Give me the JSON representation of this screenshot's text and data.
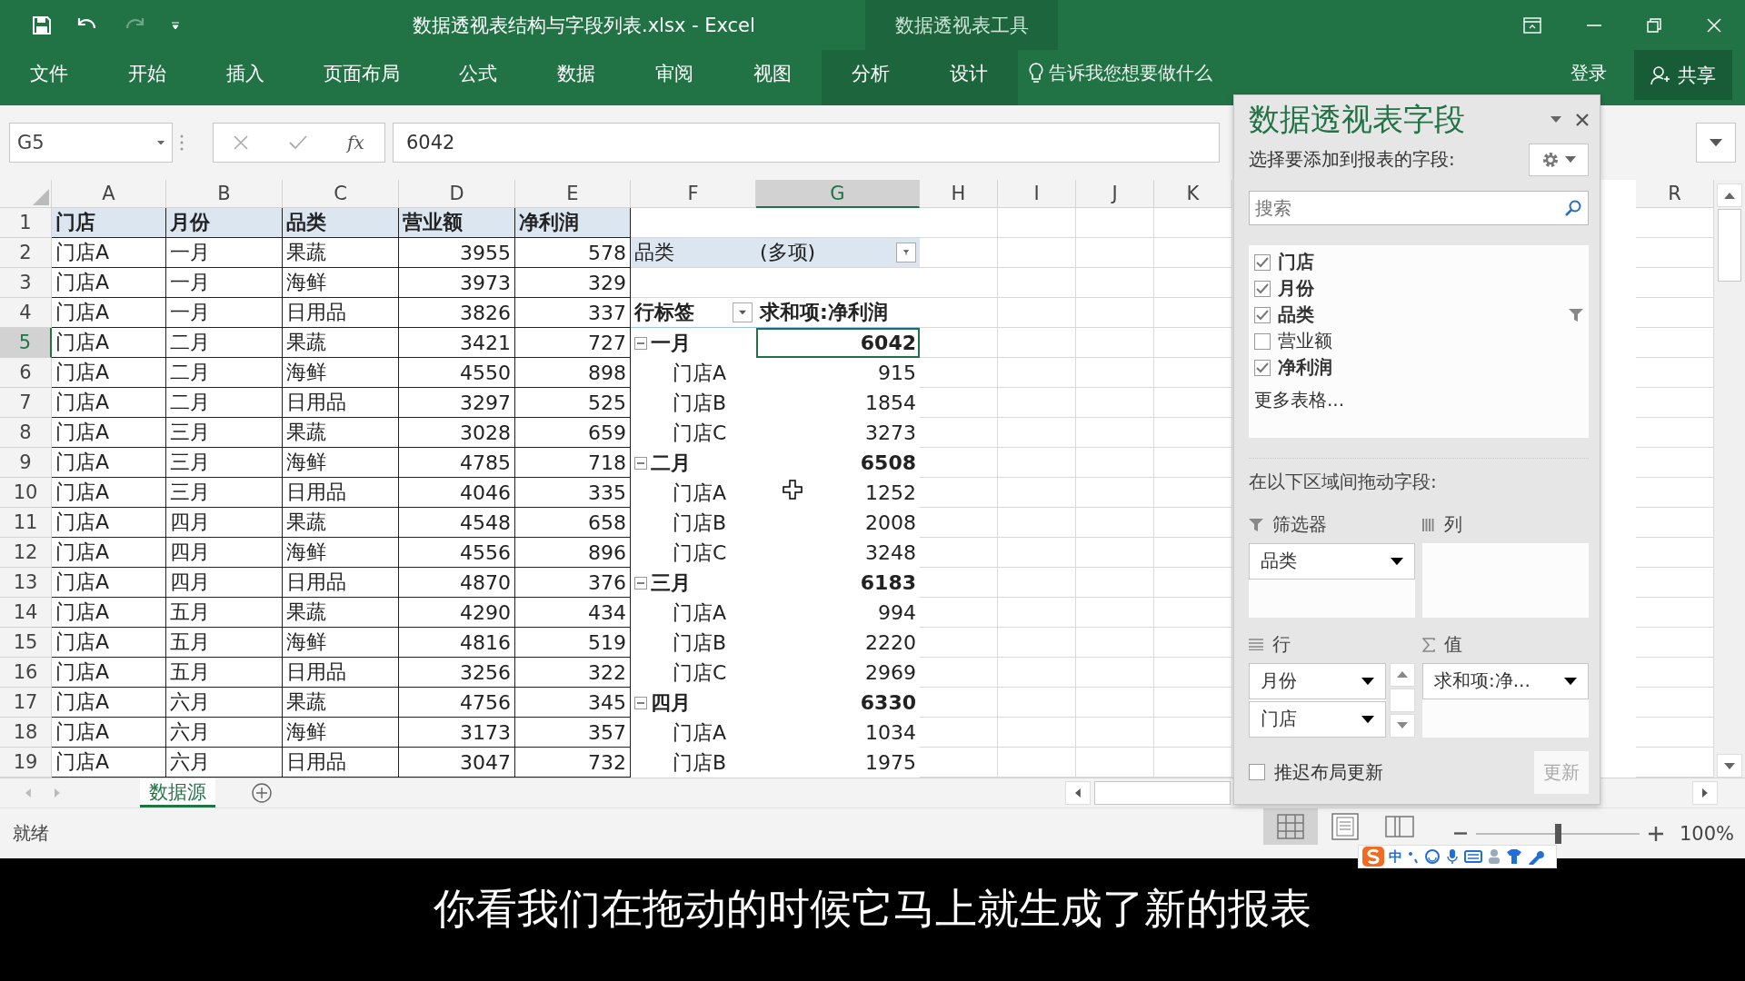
{
  "title_bar": {
    "title": "数据透视表结构与字段列表.xlsx - Excel",
    "context_label": "数据透视表工具"
  },
  "ribbon": {
    "tabs": [
      {
        "label": "文件",
        "selected": false,
        "contextual": false
      },
      {
        "label": "开始",
        "selected": false,
        "contextual": false
      },
      {
        "label": "插入",
        "selected": false,
        "contextual": false
      },
      {
        "label": "页面布局",
        "selected": false,
        "contextual": false
      },
      {
        "label": "公式",
        "selected": false,
        "contextual": false
      },
      {
        "label": "数据",
        "selected": false,
        "contextual": false
      },
      {
        "label": "审阅",
        "selected": false,
        "contextual": false
      },
      {
        "label": "视图",
        "selected": false,
        "contextual": false
      },
      {
        "label": "分析",
        "selected": false,
        "contextual": true
      },
      {
        "label": "设计",
        "selected": false,
        "contextual": true
      }
    ],
    "tell_me": "告诉我您想要做什么",
    "sign_in": "登录",
    "share": "共享"
  },
  "formula_bar": {
    "name_box": "G5",
    "function_label": "fx",
    "value": "6042"
  },
  "sheet": {
    "columns": [
      {
        "label": "A",
        "selected": false
      },
      {
        "label": "B",
        "selected": false
      },
      {
        "label": "C",
        "selected": false
      },
      {
        "label": "D",
        "selected": false
      },
      {
        "label": "E",
        "selected": false
      },
      {
        "label": "F",
        "selected": false
      },
      {
        "label": "G",
        "selected": true
      },
      {
        "label": "H",
        "selected": false
      },
      {
        "label": "I",
        "selected": false
      },
      {
        "label": "J",
        "selected": false
      },
      {
        "label": "K",
        "selected": false
      },
      {
        "label": "R",
        "selected": false
      }
    ],
    "row_headers": [
      {
        "label": "1",
        "selected": false
      },
      {
        "label": "2",
        "selected": false
      },
      {
        "label": "3",
        "selected": false
      },
      {
        "label": "4",
        "selected": false
      },
      {
        "label": "5",
        "selected": true
      },
      {
        "label": "6",
        "selected": false
      },
      {
        "label": "7",
        "selected": false
      },
      {
        "label": "8",
        "selected": false
      },
      {
        "label": "9",
        "selected": false
      },
      {
        "label": "10",
        "selected": false
      },
      {
        "label": "11",
        "selected": false
      },
      {
        "label": "12",
        "selected": false
      },
      {
        "label": "13",
        "selected": false
      },
      {
        "label": "14",
        "selected": false
      },
      {
        "label": "15",
        "selected": false
      },
      {
        "label": "16",
        "selected": false
      },
      {
        "label": "17",
        "selected": false
      },
      {
        "label": "18",
        "selected": false
      },
      {
        "label": "19",
        "selected": false
      }
    ],
    "source_table": {
      "header": [
        "门店",
        "月份",
        "品类",
        "营业额",
        "净利润"
      ],
      "rows": [
        [
          "门店A",
          "一月",
          "果蔬",
          "3955",
          "578"
        ],
        [
          "门店A",
          "一月",
          "海鲜",
          "3973",
          "329"
        ],
        [
          "门店A",
          "一月",
          "日用品",
          "3826",
          "337"
        ],
        [
          "门店A",
          "二月",
          "果蔬",
          "3421",
          "727"
        ],
        [
          "门店A",
          "二月",
          "海鲜",
          "4550",
          "898"
        ],
        [
          "门店A",
          "二月",
          "日用品",
          "3297",
          "525"
        ],
        [
          "门店A",
          "三月",
          "果蔬",
          "3028",
          "659"
        ],
        [
          "门店A",
          "三月",
          "海鲜",
          "4785",
          "718"
        ],
        [
          "门店A",
          "三月",
          "日用品",
          "4046",
          "335"
        ],
        [
          "门店A",
          "四月",
          "果蔬",
          "4548",
          "658"
        ],
        [
          "门店A",
          "四月",
          "海鲜",
          "4556",
          "896"
        ],
        [
          "门店A",
          "四月",
          "日用品",
          "4870",
          "376"
        ],
        [
          "门店A",
          "五月",
          "果蔬",
          "4290",
          "434"
        ],
        [
          "门店A",
          "五月",
          "海鲜",
          "4816",
          "519"
        ],
        [
          "门店A",
          "五月",
          "日用品",
          "3256",
          "322"
        ],
        [
          "门店A",
          "六月",
          "果蔬",
          "4756",
          "345"
        ],
        [
          "门店A",
          "六月",
          "海鲜",
          "3173",
          "357"
        ],
        [
          "门店A",
          "六月",
          "日用品",
          "3047",
          "732"
        ]
      ]
    },
    "pivot_table": {
      "filter": {
        "field": "品类",
        "value": "(多项)"
      },
      "row_label_header": "行标签",
      "value_header": "求和项:净利润",
      "rows": [
        {
          "kind": "group",
          "label": "一月",
          "value": "6042",
          "expanded": true,
          "selected": true
        },
        {
          "kind": "item",
          "label": "门店A",
          "value": "915",
          "selected": false
        },
        {
          "kind": "item",
          "label": "门店B",
          "value": "1854",
          "selected": false
        },
        {
          "kind": "item",
          "label": "门店C",
          "value": "3273",
          "selected": false
        },
        {
          "kind": "group",
          "label": "二月",
          "value": "6508",
          "expanded": true,
          "selected": false
        },
        {
          "kind": "item",
          "label": "门店A",
          "value": "1252",
          "selected": false
        },
        {
          "kind": "item",
          "label": "门店B",
          "value": "2008",
          "selected": false
        },
        {
          "kind": "item",
          "label": "门店C",
          "value": "3248",
          "selected": false
        },
        {
          "kind": "group",
          "label": "三月",
          "value": "6183",
          "expanded": true,
          "selected": false
        },
        {
          "kind": "item",
          "label": "门店A",
          "value": "994",
          "selected": false
        },
        {
          "kind": "item",
          "label": "门店B",
          "value": "2220",
          "selected": false
        },
        {
          "kind": "item",
          "label": "门店C",
          "value": "2969",
          "selected": false
        },
        {
          "kind": "group",
          "label": "四月",
          "value": "6330",
          "expanded": true,
          "selected": false
        },
        {
          "kind": "item",
          "label": "门店A",
          "value": "1034",
          "selected": false
        },
        {
          "kind": "item",
          "label": "门店B",
          "value": "1975",
          "selected": false
        }
      ]
    }
  },
  "sheet_tabs": [
    {
      "label": "数据源",
      "selected": true
    }
  ],
  "status_bar": {
    "status": "就绪",
    "views": [
      {
        "kind": "normal",
        "selected": true
      },
      {
        "kind": "page_layout",
        "selected": false
      },
      {
        "kind": "page_break",
        "selected": false
      }
    ],
    "zoom": {
      "level": 0.5,
      "reading": "100%"
    }
  },
  "ime_toolbar": {
    "mode": "中"
  },
  "field_pane": {
    "title": "数据透视表字段",
    "prompt": "选择要添加到报表的字段:",
    "search": {
      "placeholder": "搜索"
    },
    "fields": [
      {
        "label": "门店",
        "checked": true,
        "filtered": false
      },
      {
        "label": "月份",
        "checked": true,
        "filtered": false
      },
      {
        "label": "品类",
        "checked": true,
        "filtered": true
      },
      {
        "label": "营业额",
        "checked": false,
        "filtered": false
      },
      {
        "label": "净利润",
        "checked": true,
        "filtered": false
      }
    ],
    "more_tables": "更多表格...",
    "areas_prompt": "在以下区域间拖动字段:",
    "areas": [
      {
        "kind": "filters",
        "title": "筛选器",
        "items": [
          "品类"
        ]
      },
      {
        "kind": "columns",
        "title": "列"
      },
      {
        "kind": "rows",
        "title": "行",
        "items": [
          "月份",
          "门店"
        ]
      },
      {
        "kind": "values",
        "title": "值",
        "items": [
          "求和项:净..."
        ]
      }
    ],
    "defer_update": {
      "label": "推迟布局更新",
      "checked": false
    },
    "update_button": {
      "label": "更新",
      "disabled": true
    }
  },
  "subtitle": "你看我们在拖动的时候它马上就生成了新的报表"
}
